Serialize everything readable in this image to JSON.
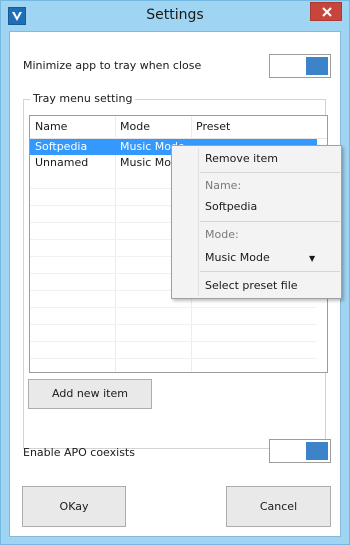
{
  "window": {
    "title": "Settings"
  },
  "minimize": {
    "label": "Minimize app to tray when close"
  },
  "tray_group": {
    "title": "Tray menu setting"
  },
  "list": {
    "columns": [
      "Name",
      "Mode",
      "Preset"
    ],
    "rows": [
      {
        "name": "Softpedia",
        "mode": "Music Mode",
        "preset": ""
      },
      {
        "name": "Unnamed",
        "mode": "Music Mode",
        "preset": ""
      }
    ]
  },
  "add_button": "Add new item",
  "apo": {
    "label": "Enable APO coexists"
  },
  "ok_button": "OKay",
  "cancel_button": "Cancel",
  "context_menu": {
    "remove": "Remove item",
    "name_caption": "Name:",
    "name_value": "Softpedia",
    "mode_caption": "Mode:",
    "mode_value": "Music Mode",
    "select_preset": "Select preset file"
  },
  "colors": {
    "title_bar": "#9fd5f2",
    "toggle_on": "#3d83c9",
    "selection": "#3399ff",
    "close": "#c7453b"
  },
  "icons": {
    "app": "v-logo-icon",
    "close": "close-icon",
    "dropdown": "dropdown-arrow-icon"
  }
}
